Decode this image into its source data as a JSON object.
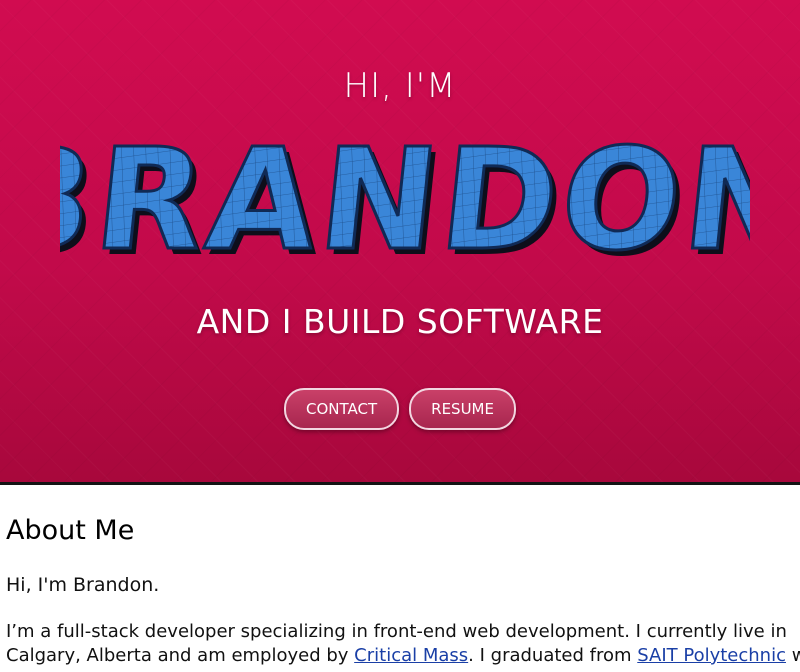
{
  "hero": {
    "greeting": "HI, I'M",
    "name": "BRANDON",
    "tagline": "AND I BUILD SOFTWARE",
    "buttons": [
      {
        "label": "CONTACT"
      },
      {
        "label": "RESUME"
      }
    ]
  },
  "about": {
    "heading": "About Me",
    "intro": "Hi, I'm Brandon.",
    "bio_line1": "I’m a full-stack developer specializing in front-end web development. I currently live in",
    "bio_line2_a": "Calgary, Alberta and am employed by ",
    "bio_link1": "Critical Mass",
    "bio_line2_b": ". I graduated from ",
    "bio_link2": "SAIT Polytechnic",
    "bio_line2_c": " with"
  },
  "colors": {
    "hero_bg": "#d10c50",
    "name_fill": "#3a86d8",
    "link": "#1a3fa6"
  }
}
